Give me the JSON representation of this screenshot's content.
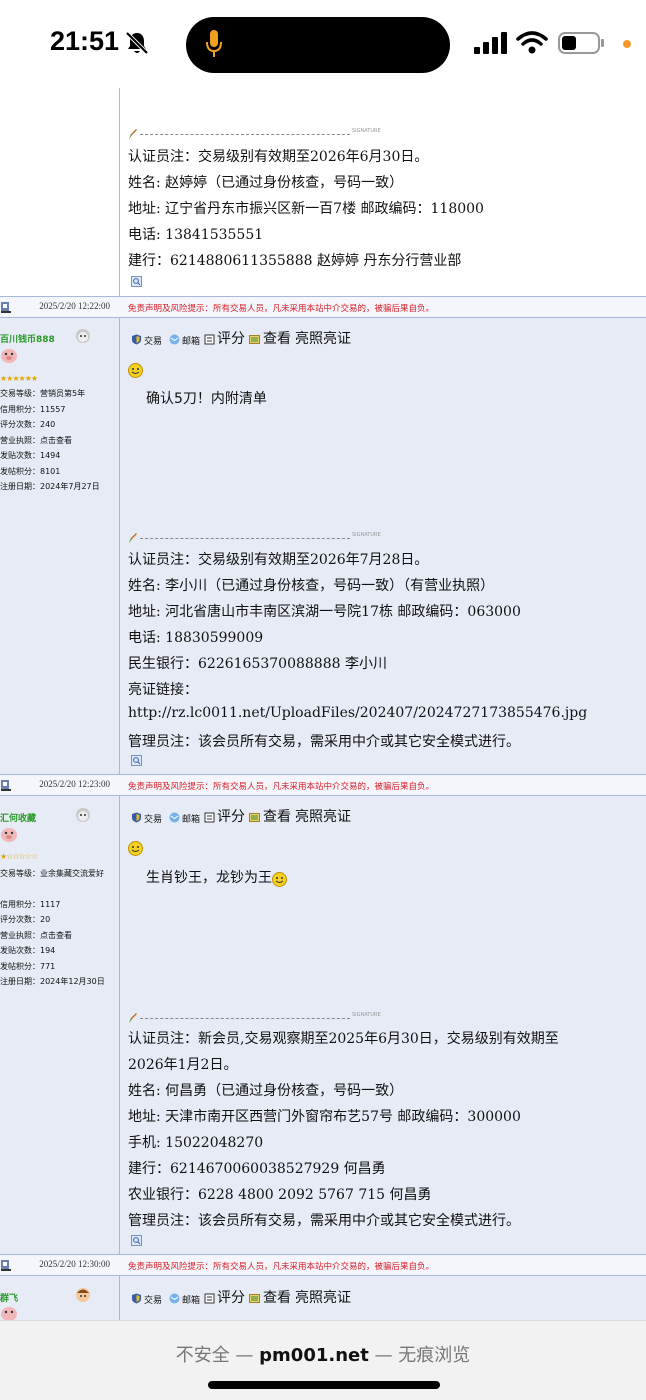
{
  "status": {
    "time": "21:51"
  },
  "toolbar": {
    "trade": "交易",
    "mailbox": "邮箱",
    "rate": "评分",
    "view": "查看",
    "license": "亮照亮证"
  },
  "sep": {
    "warning": "免责声明及风险提示：所有交易人员，凡未采用本站中介交易的，被骗后果自负。",
    "dates": [
      "2025/2/20 12:22:00",
      "2025/2/20 12:23:00",
      "2025/2/20 12:30:00"
    ]
  },
  "sig_tag": "SIGNATURE",
  "post1": {
    "lines": [
      "认证员注：交易级别有效期至2026年6月30日。",
      "姓名: 赵婷婷（已通过身份核查，号码一致）",
      "地址: 辽宁省丹东市振兴区新一百7楼     邮政编码：118000",
      "电话: 13841535551",
      "建行：6214880611355888  赵婷婷 丹东分行营业部"
    ]
  },
  "post2": {
    "user": {
      "name": "百川钱币888",
      "stats": [
        "交易等级：营销员第5年",
        "信用积分：11557",
        "评分次数：240",
        "营业执照：点击查看",
        "发贴次数：1494",
        "发帖积分：8101",
        "注册日期：2024年7月27日"
      ]
    },
    "message": "确认5刀！内附清单",
    "lines": [
      "认证员注：交易级别有效期至2026年7月28日。",
      "姓名: 李小川（已通过身份核查，号码一致）（有营业执照）",
      "地址: 河北省唐山市丰南区滨湖一号院17栋   邮政编码：063000",
      "电话: 18830599009",
      "民生银行：6226165370088888  李小川",
      "亮证链接：",
      "http://rz.lc0011.net/UploadFiles/202407/2024727173855476.jpg",
      "管理员注：该会员所有交易，需采用中介或其它安全模式进行。"
    ]
  },
  "post3": {
    "user": {
      "name": "汇何收藏",
      "stats": [
        "交易等级：业余集藏交流爱好",
        "信用积分：1117",
        "评分次数：20",
        "营业执照：点击查看",
        "发贴次数：194",
        "发帖积分：771",
        "注册日期：2024年12月30日"
      ]
    },
    "message": "生肖钞王，龙钞为王",
    "lines": [
      "认证员注：新会员,交易观察期至2025年6月30日，交易级别有效期至",
      "2026年1月2日。",
      "姓名: 何昌勇（已通过身份核查，号码一致）",
      "地址: 天津市南开区西营门外窗帘布艺57号      邮政编码：300000",
      "手机: 15022048270",
      "建行：6214670060038527929  何昌勇",
      "农业银行：6228 4800 2092 5767 715   何昌勇",
      "管理员注：该会员所有交易，需采用中介或其它安全模式进行。"
    ]
  },
  "post4": {
    "user": {
      "name": "群飞"
    }
  },
  "browser": {
    "prefix": "不安全 — ",
    "domain": "pm001.net",
    "suffix": " — 无痕浏览"
  },
  "colors": {
    "accent_green": "#2a9a2a",
    "warning_red": "#d8202a",
    "tint": "#e6ebf5"
  }
}
